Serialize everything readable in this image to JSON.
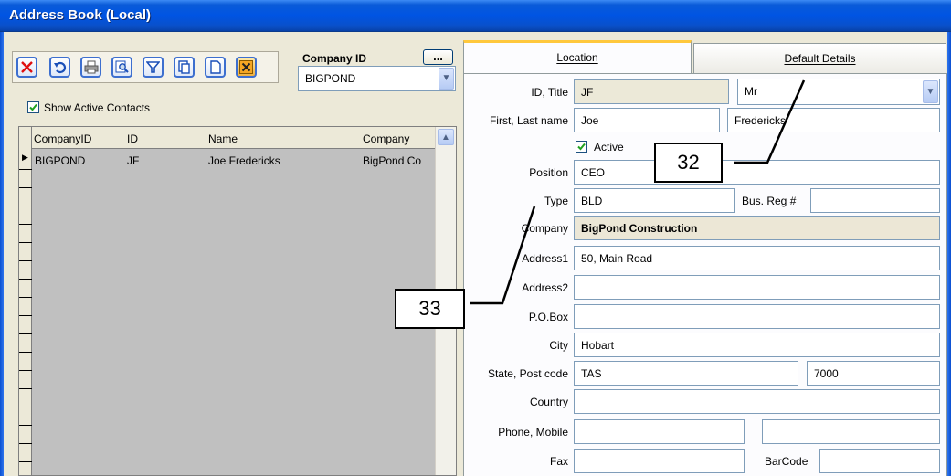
{
  "window": {
    "title": "Address Book (Local)"
  },
  "toolbar": {
    "buttons": [
      {
        "name": "delete",
        "icon": "delete-x-icon"
      },
      {
        "name": "undo",
        "icon": "undo-icon"
      },
      {
        "name": "print",
        "icon": "printer-icon"
      },
      {
        "name": "preview",
        "icon": "magnifier-icon"
      },
      {
        "name": "filter",
        "icon": "filter-icon"
      },
      {
        "name": "copy",
        "icon": "copy-icon"
      },
      {
        "name": "new",
        "icon": "new-page-icon"
      },
      {
        "name": "close",
        "icon": "close-x-icon"
      }
    ]
  },
  "company_id": {
    "label": "Company ID",
    "value": "BIGPOND",
    "ellipsis": "..."
  },
  "show_active": {
    "label": "Show Active Contacts",
    "checked": true
  },
  "grid": {
    "columns": [
      "CompanyID",
      "ID",
      "Name",
      "Company"
    ],
    "rows": [
      {
        "companyid": "BIGPOND",
        "id": "JF",
        "name": "Joe Fredericks",
        "company": "BigPond Co"
      }
    ]
  },
  "tabs": {
    "location": "Location",
    "default_details": "Default Details"
  },
  "form": {
    "id_title_label": "ID, Title",
    "id": "JF",
    "title": "Mr",
    "first_last_label": "First, Last name",
    "first": "Joe",
    "last": "Fredericks",
    "active_label": "Active",
    "position_label": "Position",
    "position": "CEO",
    "type_label": "Type",
    "type": "BLD",
    "busreg_label": "Bus. Reg #",
    "busreg": "",
    "company_label": "Company",
    "company": "BigPond Construction",
    "address1_label": "Address1",
    "address1": "50, Main Road",
    "address2_label": "Address2",
    "address2": "",
    "pobox_label": "P.O.Box",
    "pobox": "",
    "city_label": "City",
    "city": "Hobart",
    "state_post_label": "State, Post code",
    "state": "TAS",
    "postcode": "7000",
    "country_label": "Country",
    "country": "",
    "phone_mobile_label": "Phone, Mobile",
    "phone": "",
    "mobile": "",
    "fax_label": "Fax",
    "fax": "",
    "barcode_label": "BarCode",
    "barcode": ""
  },
  "callouts": {
    "a": "32",
    "b": "33"
  }
}
